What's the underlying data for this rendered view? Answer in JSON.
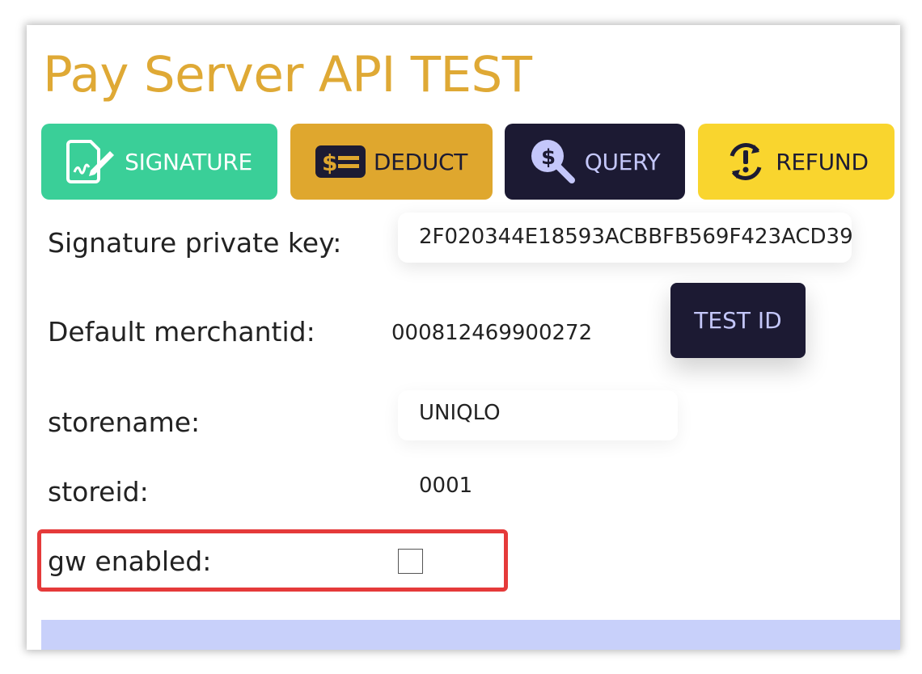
{
  "page": {
    "title": "Pay Server API TEST"
  },
  "toolbar": {
    "signature": {
      "label": "SIGNATURE",
      "icon": "signature-document-icon",
      "color": "#3ACF98"
    },
    "deduct": {
      "label": "DEDUCT",
      "icon": "money-bill-icon",
      "color": "#DFA72E"
    },
    "query": {
      "label": "QUERY",
      "icon": "dollar-search-icon",
      "color": "#1C1A33"
    },
    "refund": {
      "label": "REFUND",
      "icon": "refund-alert-icon",
      "color": "#F9D52E"
    }
  },
  "form": {
    "private_key": {
      "label": "Signature private key:",
      "value": "2F020344E18593ACBBFB569F423ACD39"
    },
    "merchant": {
      "label": "Default merchantid:",
      "value": "000812469900272",
      "button": "TEST ID"
    },
    "storename": {
      "label": "storename:",
      "value": "UNIQLO"
    },
    "storeid": {
      "label": "storeid:",
      "value": "0001"
    },
    "gw_enabled": {
      "label": "gw enabled:",
      "checked": false
    }
  },
  "colors": {
    "title": "#DFA935",
    "highlight": "#E53A3A",
    "footer": "#C8D0FA"
  }
}
